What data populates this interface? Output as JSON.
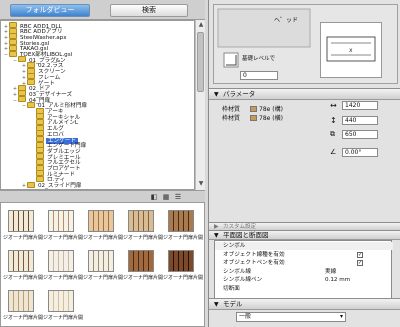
{
  "tabs": {
    "folder_view": "フォルダビュー",
    "search": "検索"
  },
  "tree": {
    "items": [
      {
        "label": "RBC ADD1 DLL",
        "level": 0,
        "toggle": "+",
        "selected": false
      },
      {
        "label": "RBC ADDアプリ",
        "level": 0,
        "toggle": "+",
        "selected": false
      },
      {
        "label": "SteelWasher.apx",
        "level": 0,
        "toggle": "+",
        "selected": false
      },
      {
        "label": "Stories.gsl",
        "level": 0,
        "toggle": "+",
        "selected": false
      },
      {
        "label": "TAKAO.gsl",
        "level": 0,
        "toggle": "+",
        "selected": false
      },
      {
        "label": "TOEX部材LIBOL.gsl",
        "level": 0,
        "toggle": "−",
        "selected": false
      },
      {
        "label": "01_プラグ&ン",
        "level": 1,
        "toggle": "−",
        "selected": false
      },
      {
        "label": "02.2.ラス",
        "level": 2,
        "toggle": "+",
        "selected": false
      },
      {
        "label": "スクリーン",
        "level": 2,
        "toggle": "+",
        "selected": false
      },
      {
        "label": "フレーム",
        "level": 2,
        "toggle": "+",
        "selected": false
      },
      {
        "label": "ゲート",
        "level": 2,
        "toggle": "+",
        "selected": false
      },
      {
        "label": "02_ドア",
        "level": 1,
        "toggle": "+",
        "selected": false
      },
      {
        "label": "03_デザイナーズ",
        "level": 1,
        "toggle": "+",
        "selected": false
      },
      {
        "label": "04_門扉",
        "level": 1,
        "toggle": "−",
        "selected": false
      },
      {
        "label": "01_アルミ形材門扉",
        "level": 2,
        "toggle": "−",
        "selected": false
      },
      {
        "label": "アーキ",
        "level": 3,
        "toggle": "",
        "selected": false
      },
      {
        "label": "アーキシャル",
        "level": 3,
        "toggle": "",
        "selected": false
      },
      {
        "label": "アルメインL",
        "level": 3,
        "toggle": "",
        "selected": false
      },
      {
        "label": "エルグ",
        "level": 3,
        "toggle": "",
        "selected": false
      },
      {
        "label": "エロバ",
        "level": 3,
        "toggle": "",
        "selected": false
      },
      {
        "label": "エンゲート",
        "level": 3,
        "toggle": "",
        "selected": true
      },
      {
        "label": "エンゲート門扉",
        "level": 3,
        "toggle": "",
        "selected": false
      },
      {
        "label": "ダブルエッジ",
        "level": 3,
        "toggle": "",
        "selected": false
      },
      {
        "label": "プレミエール",
        "level": 3,
        "toggle": "",
        "selected": false
      },
      {
        "label": "フルエクセル",
        "level": 3,
        "toggle": "",
        "selected": false
      },
      {
        "label": "ブロアゲート",
        "level": 3,
        "toggle": "",
        "selected": false
      },
      {
        "label": "ルミナード",
        "level": 3,
        "toggle": "",
        "selected": false
      },
      {
        "label": "ロ.ディ",
        "level": 3,
        "toggle": "",
        "selected": false
      },
      {
        "label": "02_スライド門扉",
        "level": 2,
        "toggle": "+",
        "selected": false
      }
    ]
  },
  "thumbs": [
    {
      "cap": "ジオーナ門扉片開き",
      "color": "#f2ead8",
      "stripe": "#6b4a2a"
    },
    {
      "cap": "ジオーナ門扉片開き",
      "color": "#f7f2e6",
      "stripe": "#b09070"
    },
    {
      "cap": "ジオーナ門扉片開き",
      "color": "#e8c79c",
      "stripe": "#a07040"
    },
    {
      "cap": "ジオーナ門扉片開き",
      "color": "#d8bd94",
      "stripe": "#806040"
    },
    {
      "cap": "ジオーナ門扉片開き",
      "color": "#a87a4e",
      "stripe": "#4a2a10"
    },
    {
      "cap": "ジオーナ門扉片開き",
      "color": "#f2ead8",
      "stripe": "#7a5a3a"
    },
    {
      "cap": "ジオーナ門扉片開き",
      "color": "#f4f0e8",
      "stripe": "#c8b8a0"
    },
    {
      "cap": "ジオーナ門扉片開き",
      "color": "#f3efe4",
      "stripe": "#9a8a70"
    },
    {
      "cap": "ジオーナ門扉片開き",
      "color": "#a06a3e",
      "stripe": "#4a2a10"
    },
    {
      "cap": "ジオーナ門扉片開き",
      "color": "#7a4a2a",
      "stripe": "#2a1000"
    },
    {
      "cap": "ジオーナ門扉片開き",
      "color": "#eee6d2",
      "stripe": "#b8a070"
    },
    {
      "cap": "ジオーナ門扉片開き",
      "color": "#f5efe2",
      "stripe": "#d0c0a0"
    }
  ],
  "preview": {
    "label": "ヘ゜ッド",
    "elev_label": "基礎レベルで",
    "elev_value": "0"
  },
  "parameters": {
    "header": "パラメータ",
    "mat1_label": "枠材質",
    "mat1_value": "78e (構)",
    "mat2_label": "枠材質",
    "mat2_value": "78e (横)",
    "width": "1420",
    "height": "440",
    "depth": "650",
    "angle": "0.00°"
  },
  "sections": {
    "custom": "カスタム設定",
    "floor_plan": "平面図と断面図",
    "model": "モデル"
  },
  "plist": [
    {
      "k": "シンボル",
      "v": "",
      "check": ""
    },
    {
      "k": "オブジェクト線種を有効",
      "v": "",
      "check": "✓"
    },
    {
      "k": "オブジェクトペンを有効",
      "v": "",
      "check": "✓"
    },
    {
      "k": "シンボル線",
      "v": "実線",
      "check": ""
    },
    {
      "k": "シンボル線ペン",
      "v": "0.12 mm",
      "check": ""
    },
    {
      "k": "切断面",
      "v": "",
      "check": ""
    }
  ],
  "model_dropdown": "一般",
  "layer_value": "0"
}
